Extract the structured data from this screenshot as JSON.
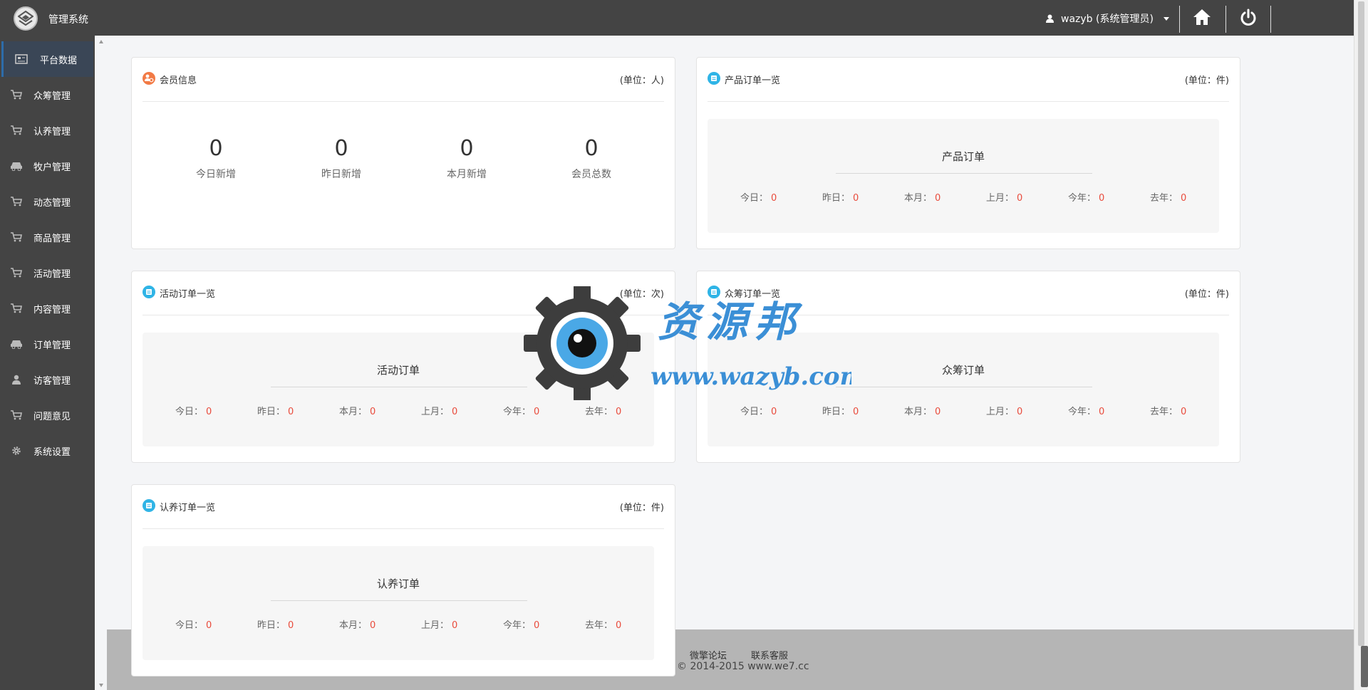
{
  "app": {
    "title": "管理系统"
  },
  "user": {
    "name": "wazyb (系统管理员)"
  },
  "sidebar": {
    "items": [
      {
        "label": "平台数据",
        "icon": "dashboard-icon",
        "active": true
      },
      {
        "label": "众筹管理",
        "icon": "cart-icon"
      },
      {
        "label": "认养管理",
        "icon": "cart-icon"
      },
      {
        "label": "牧户管理",
        "icon": "car-icon"
      },
      {
        "label": "动态管理",
        "icon": "cart-icon"
      },
      {
        "label": "商品管理",
        "icon": "cart-icon"
      },
      {
        "label": "活动管理",
        "icon": "cart-icon"
      },
      {
        "label": "内容管理",
        "icon": "cart-icon"
      },
      {
        "label": "订单管理",
        "icon": "car-icon"
      },
      {
        "label": "访客管理",
        "icon": "user-icon"
      },
      {
        "label": "问题意见",
        "icon": "cart-icon"
      },
      {
        "label": "系统设置",
        "icon": "gear-icon"
      }
    ]
  },
  "member": {
    "title": "会员信息",
    "unit": "(单位：人)",
    "stats": [
      {
        "value": "0",
        "label": "今日新增"
      },
      {
        "value": "0",
        "label": "昨日新增"
      },
      {
        "value": "0",
        "label": "本月新增"
      },
      {
        "value": "0",
        "label": "会员总数"
      }
    ]
  },
  "orders": {
    "product": {
      "title": "产品订单一览",
      "unit": "(单位：件)",
      "box_title": "产品订单",
      "stats": [
        {
          "label": "今日：",
          "value": "0"
        },
        {
          "label": "昨日：",
          "value": "0"
        },
        {
          "label": "本月：",
          "value": "0"
        },
        {
          "label": "上月：",
          "value": "0"
        },
        {
          "label": "今年：",
          "value": "0"
        },
        {
          "label": "去年：",
          "value": "0"
        }
      ]
    },
    "activity": {
      "title": "活动订单一览",
      "unit": "(单位：次)",
      "box_title": "活动订单",
      "stats": [
        {
          "label": "今日：",
          "value": "0"
        },
        {
          "label": "昨日：",
          "value": "0"
        },
        {
          "label": "本月：",
          "value": "0"
        },
        {
          "label": "上月：",
          "value": "0"
        },
        {
          "label": "今年：",
          "value": "0"
        },
        {
          "label": "去年：",
          "value": "0"
        }
      ]
    },
    "crowdfund": {
      "title": "众筹订单一览",
      "unit": "(单位：件)",
      "box_title": "众筹订单",
      "stats": [
        {
          "label": "今日：",
          "value": "0"
        },
        {
          "label": "昨日：",
          "value": "0"
        },
        {
          "label": "本月：",
          "value": "0"
        },
        {
          "label": "上月：",
          "value": "0"
        },
        {
          "label": "今年：",
          "value": "0"
        },
        {
          "label": "去年：",
          "value": "0"
        }
      ]
    },
    "adopt": {
      "title": "认养订单一览",
      "unit": "(单位：件)",
      "box_title": "认养订单",
      "stats": [
        {
          "label": "今日：",
          "value": "0"
        },
        {
          "label": "昨日：",
          "value": "0"
        },
        {
          "label": "本月：",
          "value": "0"
        },
        {
          "label": "上月：",
          "value": "0"
        },
        {
          "label": "今年：",
          "value": "0"
        },
        {
          "label": "去年：",
          "value": "0"
        }
      ]
    }
  },
  "watermark": {
    "name": "资源邦",
    "url": "www.wazyb.com"
  },
  "footer": {
    "links": [
      "微擎论坛",
      "联系客服"
    ],
    "copyright": "© 2014-2015 www.we7.cc"
  },
  "colors": {
    "accent": "#2d6caa",
    "value_red": "#e94b3c",
    "icon_orange": "#f27a45",
    "icon_blue": "#2fb4e6"
  }
}
